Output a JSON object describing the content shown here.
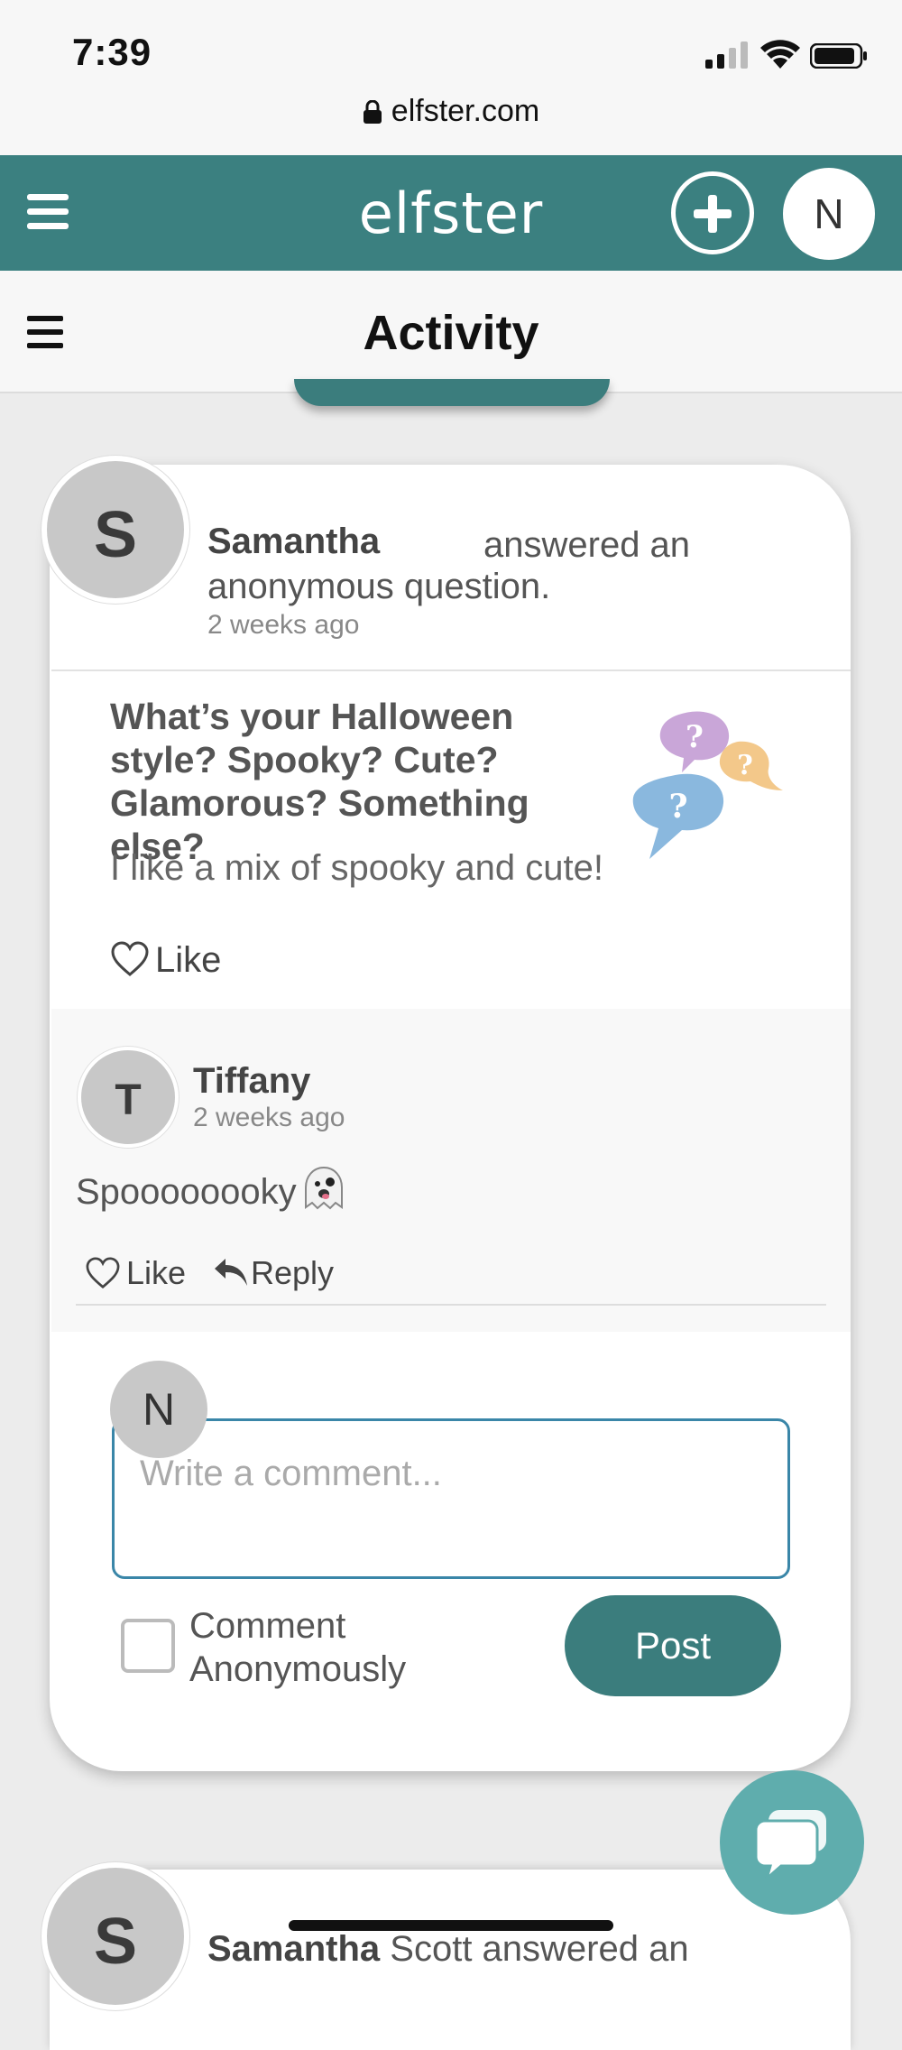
{
  "status_bar": {
    "time": "7:39",
    "url": "elfster.com"
  },
  "app_header": {
    "logo": "elfster",
    "user_initial": "N"
  },
  "page": {
    "title": "Activity"
  },
  "post": {
    "author_initial": "S",
    "author": "Samantha",
    "action_line1": "answered an",
    "action_line2": "anonymous question.",
    "time": "2 weeks ago",
    "question": "What’s your Halloween style? Spooky? Cute? Glamorous? Something else?",
    "answer": "I like a mix of spooky and cute!",
    "like_label": "Like"
  },
  "comment": {
    "author_initial": "T",
    "author": "Tiffany",
    "time": "2 weeks ago",
    "text": "Spoooooooky",
    "like_label": "Like",
    "reply_label": "Reply"
  },
  "composer": {
    "user_initial": "N",
    "placeholder": "Write a comment...",
    "anon_line1": "Comment",
    "anon_line2": "Anonymously",
    "post_label": "Post"
  },
  "next_post": {
    "author_initial": "S",
    "author": "Samantha",
    "rest": " Scott  answered an"
  },
  "colors": {
    "brand": "#3b8080",
    "button": "#3b7d7d",
    "chat_fab": "#5fadad",
    "input_border": "#3a86a8"
  },
  "icons": [
    "menu-icon",
    "plus-icon",
    "heart-icon",
    "reply-icon",
    "ghost-emoji",
    "chat-icon",
    "lock-icon",
    "speech-bubbles-question-icon"
  ]
}
